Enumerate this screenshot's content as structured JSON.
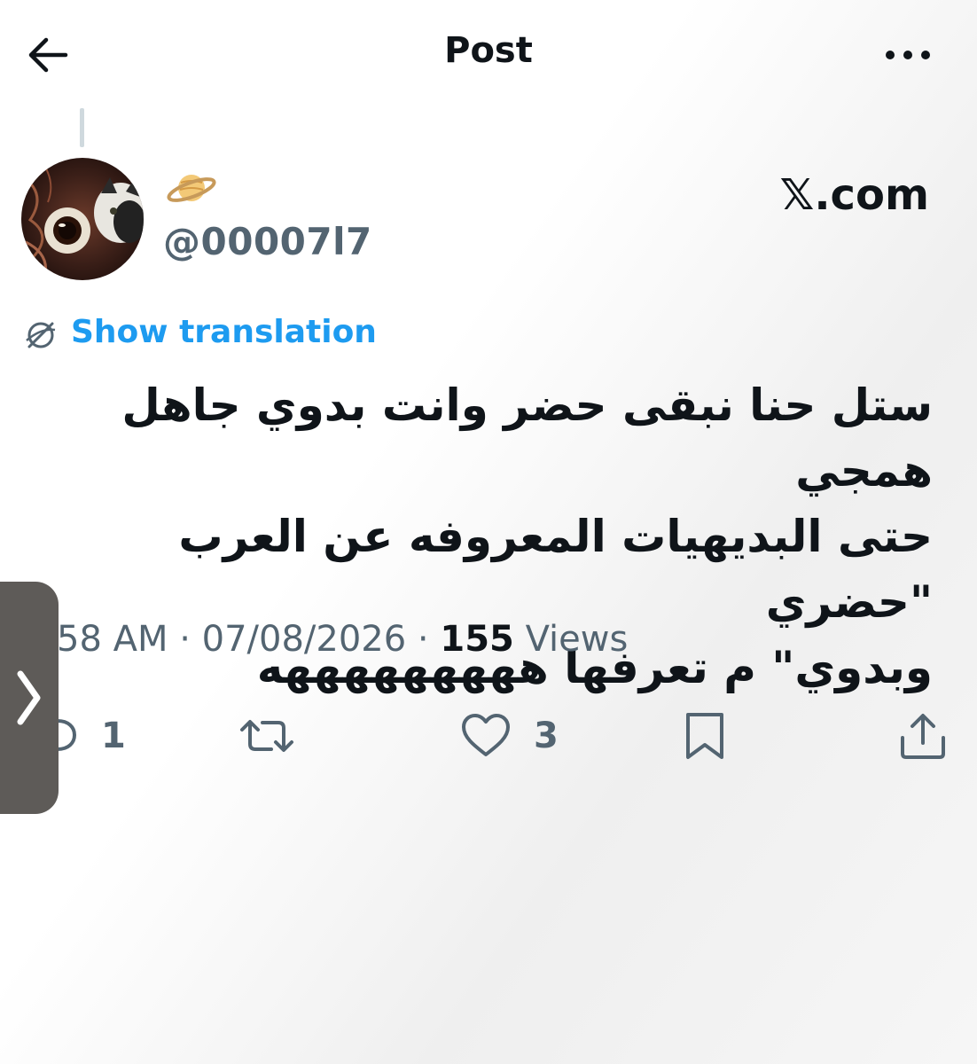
{
  "header": {
    "title": "Post"
  },
  "author": {
    "handle": "@00007l7",
    "display_emoji": "saturn-planet-emoji"
  },
  "watermark": "𝕏.com",
  "translation": {
    "label": "Show translation"
  },
  "post": {
    "lines": [
      "ستل حنا نبقى حضر وانت بدوي جاهل همجي",
      "حتى البديهيات المعروفه عن العرب \"حضري",
      "وبدوي\" م تعرفها هههههههههه"
    ],
    "time": "58 AM",
    "sep1": " · ",
    "date": "07/08/2026",
    "sep2": " · ",
    "views_count": "155",
    "views_label": " Views"
  },
  "actions": {
    "reply_count": "1",
    "like_count": "3"
  },
  "icons": {
    "back": "arrow-left-icon",
    "more": "more-horizontal-icon",
    "translate": "globe-translate-icon",
    "reply": "reply-icon",
    "repost": "repost-icon",
    "like": "heart-icon",
    "bookmark": "bookmark-icon",
    "share": "share-icon",
    "side_handle": "chevron-right-icon"
  },
  "colors": {
    "accent": "#1d9bf0",
    "text": "#0f1419",
    "muted": "#536471"
  }
}
